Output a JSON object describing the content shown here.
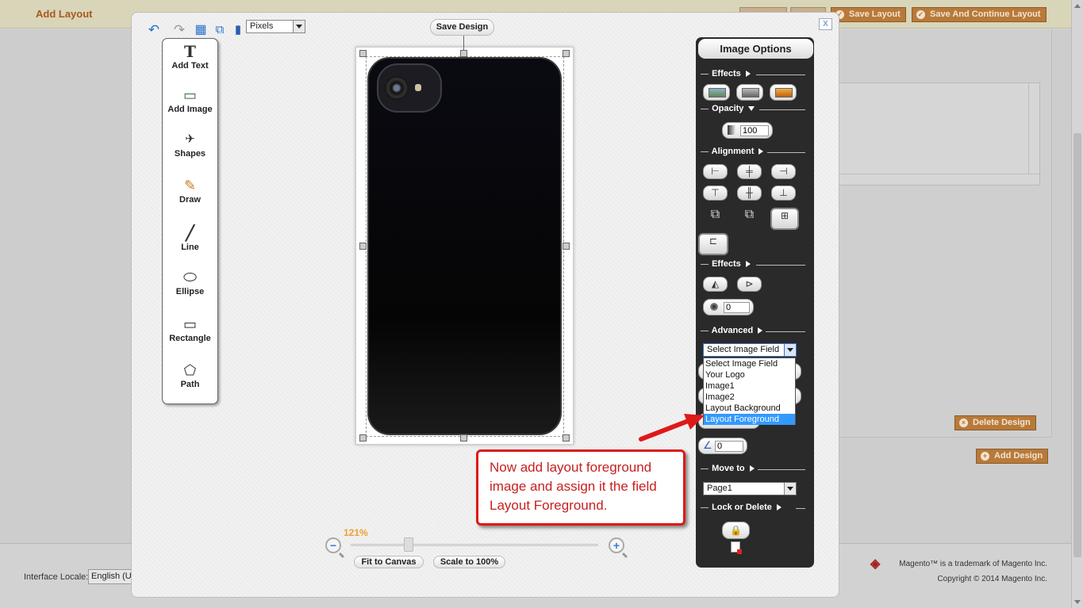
{
  "background": {
    "page_title": "Add Layout",
    "header_buttons": [
      {
        "label": "Save Layout",
        "icon": "check-icon"
      },
      {
        "label": "Save And Continue Layout",
        "icon": "check-icon"
      }
    ],
    "delete_design_label": "Delete Design",
    "add_design_label": "Add Design",
    "footer": {
      "locale_label": "Interface Locale:",
      "locale_value": "English (United States)",
      "trademark": "Magento™ is a trademark of Magento Inc.",
      "copyright": "Copyright © 2014 Magento Inc."
    }
  },
  "modal": {
    "close_label": "X",
    "units_select": "Pixels",
    "save_design_label": "Save Design",
    "tools": [
      {
        "label": "Add Text",
        "icon": "text-icon",
        "glyph": "T"
      },
      {
        "label": "Add Image",
        "icon": "image-icon",
        "glyph": "▭"
      },
      {
        "label": "Shapes",
        "icon": "shapes-icon",
        "glyph": "✈"
      },
      {
        "label": "Draw",
        "icon": "pencil-icon",
        "glyph": "✎"
      },
      {
        "label": "Line",
        "icon": "line-icon",
        "glyph": "╱"
      },
      {
        "label": "Ellipse",
        "icon": "ellipse-icon",
        "glyph": "⬭"
      },
      {
        "label": "Rectangle",
        "icon": "rectangle-icon",
        "glyph": "▭"
      },
      {
        "label": "Path",
        "icon": "path-icon",
        "glyph": "⬠"
      }
    ],
    "zoom": {
      "percent_label": "121%",
      "level": 121,
      "fit_label": "Fit to Canvas",
      "scale_label": "Scale to 100%"
    }
  },
  "options": {
    "title": "Image Options",
    "sections": {
      "effects": "Effects",
      "opacity": "Opacity",
      "alignment": "Alignment",
      "effects2": "Effects",
      "advanced": "Advanced",
      "move_to": "Move to",
      "lock_delete": "Lock or Delete"
    },
    "opacity_value": "100",
    "blur_value": "0",
    "angle_value": "0",
    "image_field_select": "Select Image Field",
    "image_field_options": [
      "Select Image Field",
      "Your Logo",
      "Image1",
      "Image2",
      "Layout Background",
      "Layout Foreground"
    ],
    "highlighted_option": "Layout Foreground",
    "move_to_value": "Page1",
    "lock_glyph": "🔒"
  },
  "callout": {
    "text": "Now add layout foreground image and assign it the field Layout Foreground.",
    "color": "#e01818"
  }
}
